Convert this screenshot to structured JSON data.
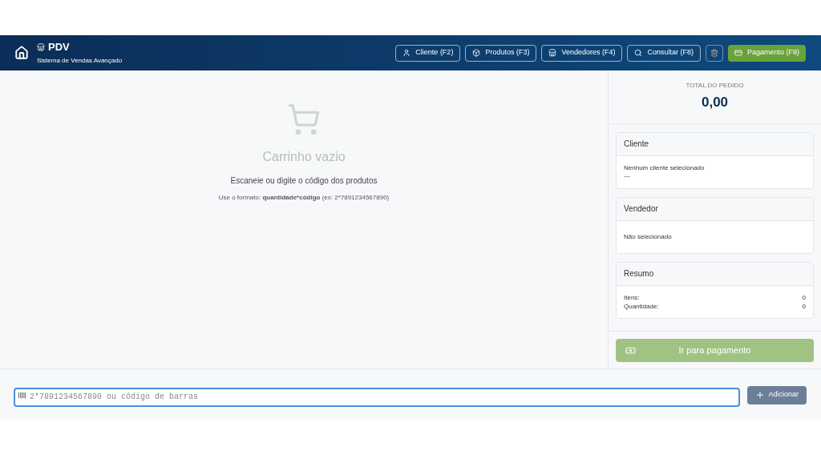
{
  "header": {
    "title": "PDV",
    "subtitle": "Sistema de Vendas Avançado",
    "buttons": [
      {
        "kind": "outline",
        "label": "Cliente (F2)"
      },
      {
        "kind": "outline",
        "label": "Produtos (F3)"
      },
      {
        "kind": "outline",
        "label": "Vendedores (F4)"
      },
      {
        "kind": "outline",
        "label": "Consultar (F8)"
      },
      {
        "kind": "icon"
      },
      {
        "kind": "primary",
        "label": "Pagamento (F9)"
      }
    ]
  },
  "cart": {
    "title": "Carrinho vazio",
    "hint": "Escaneie ou digite o código dos produtos",
    "format": "Use o formato: **quantidade*código** (ex: 2*7891234567890)"
  },
  "total": {
    "label": "TOTAL DO PEDIDO",
    "value": "0,00"
  },
  "cards": [
    {
      "kind": "text",
      "title": "Cliente",
      "lines": [
        "Nenhum cliente selecionado",
        "---"
      ]
    },
    {
      "kind": "text",
      "title": "Vendedor",
      "lines": [
        "Não selecionado"
      ]
    },
    {
      "kind": "rows",
      "title": "Resumo",
      "rows": [
        {
          "label": "Itens:",
          "value": "0"
        },
        {
          "label": "Quantidade:",
          "value": "0"
        }
      ]
    }
  ],
  "pay_button": {
    "label": "Ir para pagamento",
    "disabled": true
  },
  "entry": {
    "placeholder": "2*7891234567890 ou código de barras",
    "button": "Adicionar"
  }
}
